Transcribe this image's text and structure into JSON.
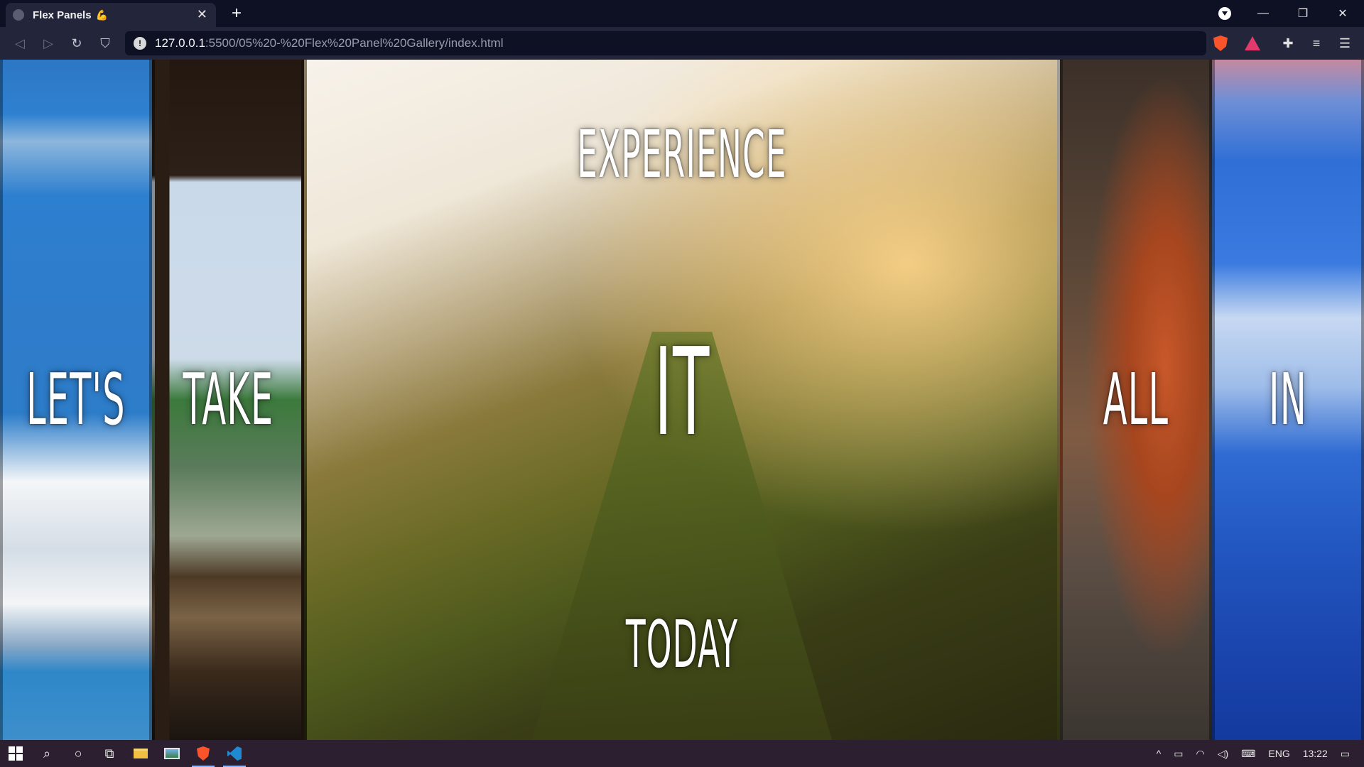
{
  "browser": {
    "tab": {
      "title": "Flex Panels",
      "emoji": "💪",
      "close": "✕"
    },
    "new_tab": "+",
    "window_controls": {
      "minimize": "—",
      "maximize": "❐",
      "close": "✕"
    },
    "nav": {
      "back": "◁",
      "forward": "▷",
      "reload": "↻",
      "bookmark": "⛉"
    },
    "address": {
      "host": "127.0.0.1",
      "path": ":5500/05%20-%20Flex%20Panel%20Gallery/index.html",
      "info": "!"
    },
    "toolbar_icons": {
      "extensions": "✚",
      "playlist": "≡",
      "menu": "☰"
    }
  },
  "panels": [
    {
      "top": "",
      "mid": "Let's",
      "bot": "",
      "open": false,
      "theme": "clouds-snow"
    },
    {
      "top": "",
      "mid": "Take",
      "bot": "",
      "open": false,
      "theme": "dock-lake"
    },
    {
      "top": "Experience",
      "mid": "It",
      "bot": "Today",
      "open": true,
      "theme": "mountain-ridge"
    },
    {
      "top": "",
      "mid": "All",
      "bot": "",
      "open": false,
      "theme": "fox"
    },
    {
      "top": "",
      "mid": "In",
      "bot": "",
      "open": false,
      "theme": "blue-sky"
    }
  ],
  "taskbar": {
    "search": "⌕",
    "cortana": "○",
    "task_view": "⧉",
    "tray": {
      "chevron": "^",
      "language": "ENG",
      "time": "13:22",
      "notifications": "▭"
    }
  },
  "colors": {
    "tabbar": "#0e1024",
    "toolbar": "#23263a",
    "taskbar": "#2c1f30",
    "brave": "#fb542b"
  }
}
